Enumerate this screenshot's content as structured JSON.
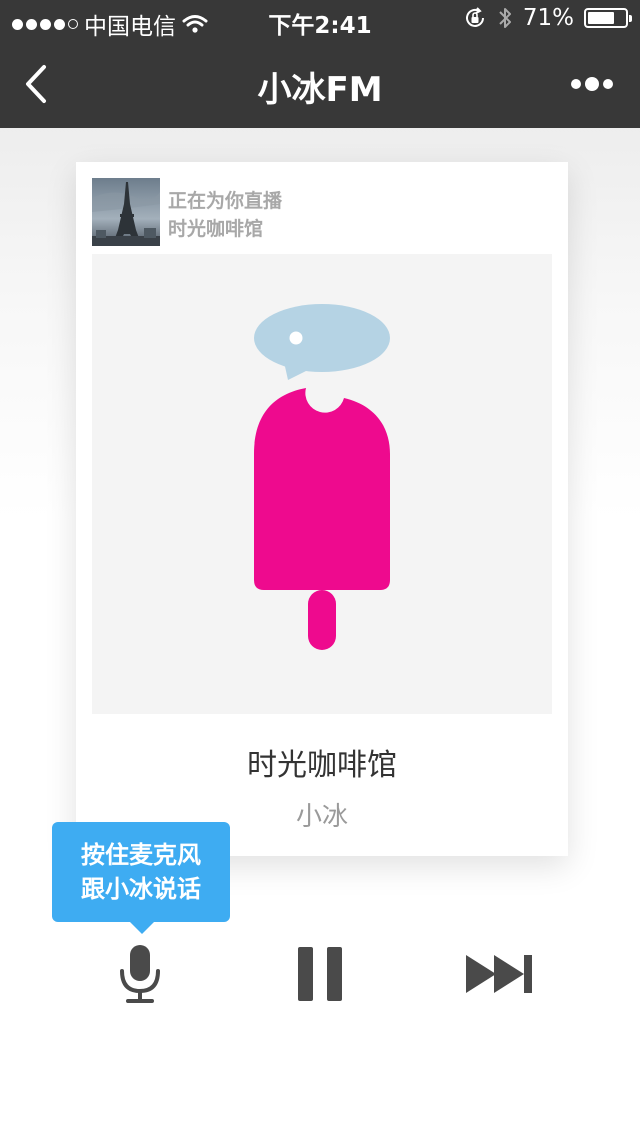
{
  "status_bar": {
    "carrier": "中国电信",
    "time": "下午2:41",
    "battery_text": "71%",
    "battery_level": 0.71
  },
  "nav": {
    "title": "小冰FM",
    "back_icon": "chevron-left-icon",
    "more_icon": "more-dots-icon"
  },
  "now_playing": {
    "status_label": "正在为你直播",
    "station": "时光咖啡馆",
    "song_title": "时光咖啡馆",
    "artist": "小冰"
  },
  "tooltip": {
    "line1": "按住麦克风",
    "line2": "跟小冰说话"
  },
  "controls": {
    "mic_icon": "microphone-icon",
    "pause_icon": "pause-icon",
    "next_icon": "skip-next-icon"
  },
  "colors": {
    "header_bg": "#383838",
    "accent": "#3eacf2",
    "popsicle": "#ee0a8e",
    "bubble": "#b5d3e4",
    "control_icon": "#4a4a4a"
  }
}
